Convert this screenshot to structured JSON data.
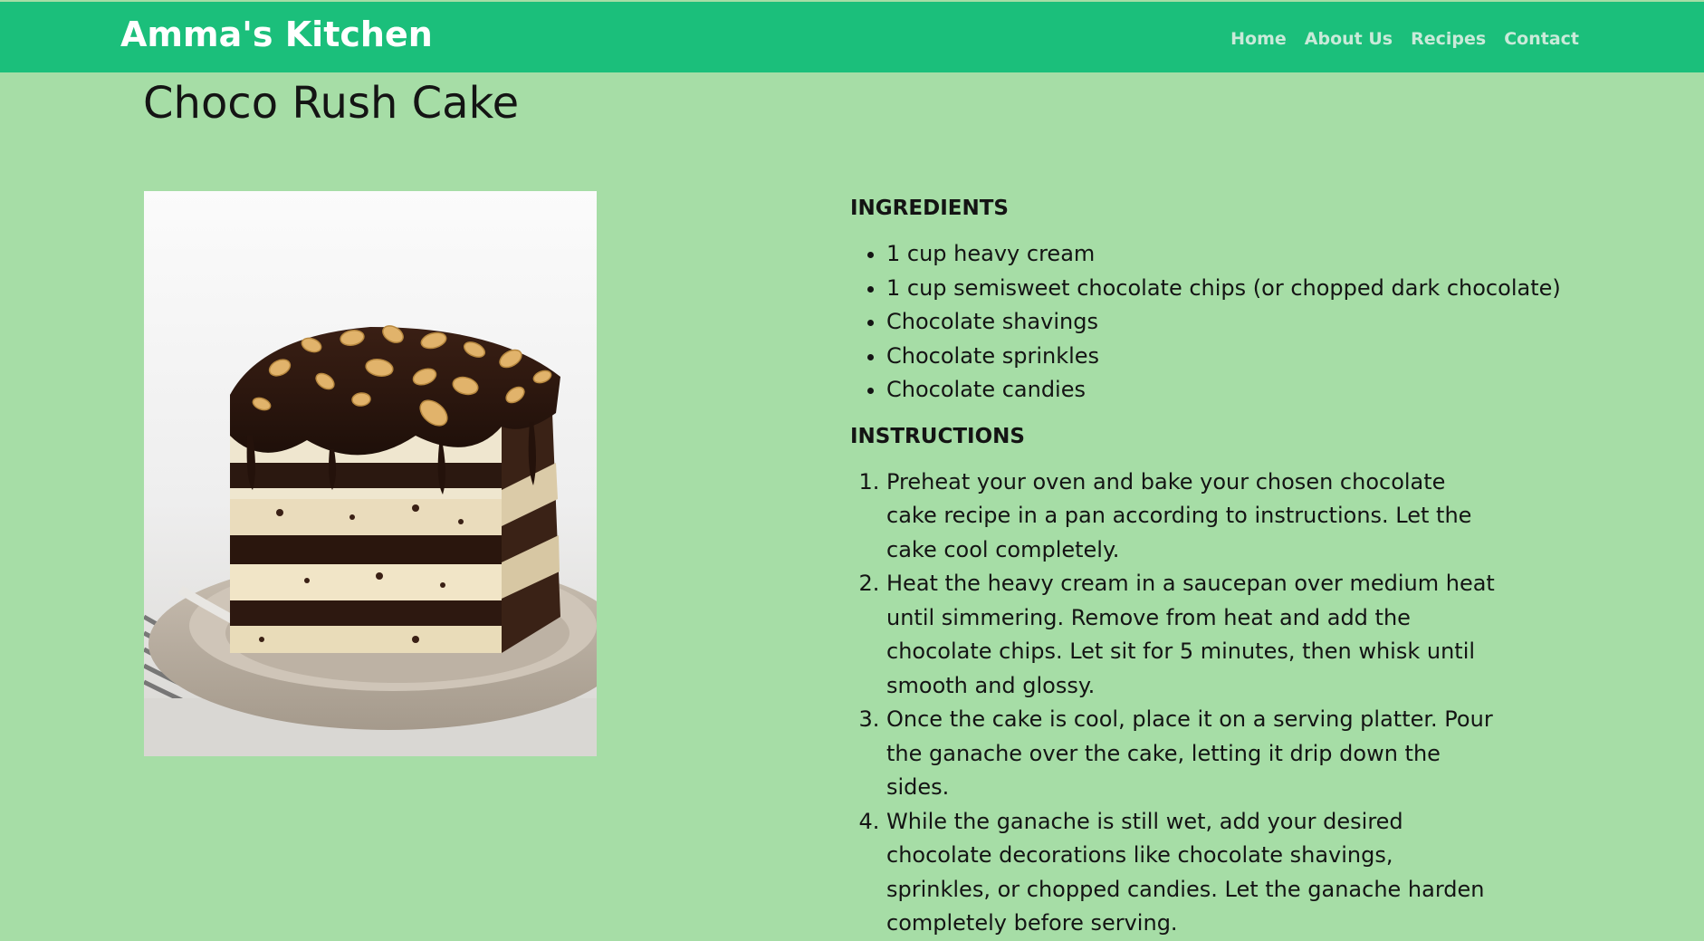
{
  "header": {
    "brand": "Amma's Kitchen",
    "nav": [
      "Home",
      "About Us",
      "Recipes",
      "Contact"
    ]
  },
  "recipe": {
    "title": "Choco Rush Cake",
    "ingredients_heading": "INGREDIENTS",
    "ingredients": [
      "1 cup heavy cream",
      "1 cup semisweet chocolate chips (or chopped dark chocolate)",
      "Chocolate shavings",
      "Chocolate sprinkles",
      "Chocolate candies"
    ],
    "instructions_heading": "INSTRUCTIONS",
    "instructions": [
      "Preheat your oven and bake your chosen chocolate cake recipe in a pan according to instructions. Let the cake cool completely.",
      "Heat the heavy cream in a saucepan over medium heat until simmering. Remove from heat and add the chocolate chips. Let sit for 5 minutes, then whisk until smooth and glossy.",
      "Once the cake is cool, place it on a serving platter. Pour the ganache over the cake, letting it drip down the sides.",
      "While the ganache is still wet, add your desired chocolate decorations like chocolate shavings, sprinkles, or chopped candies. Let the ganache harden completely before serving."
    ]
  },
  "colors": {
    "navbar": "#1bbf7b",
    "page_background": "#a6dda6",
    "brand_text": "#ffffff",
    "nav_text": "#c9ead9",
    "body_text": "#141414"
  }
}
